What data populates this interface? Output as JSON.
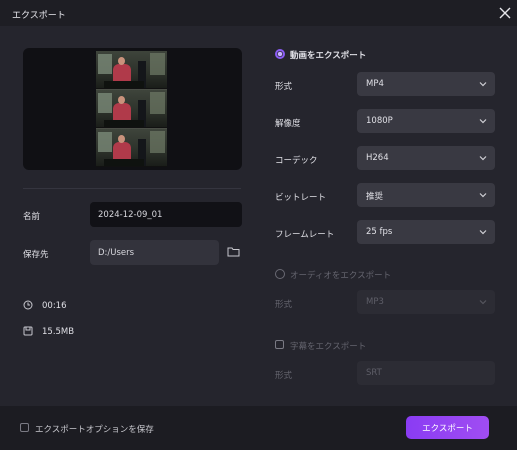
{
  "window": {
    "title": "エクスポート"
  },
  "left": {
    "name_label": "名前",
    "name_value": "2024-12-09_01",
    "save_label": "保存先",
    "save_value": "D:/Users",
    "duration": "00:16",
    "size": "15.5MB"
  },
  "video_section": {
    "radio_label": "動画をエクスポート",
    "rows": [
      {
        "label": "形式",
        "value": "MP4"
      },
      {
        "label": "解像度",
        "value": "1080P"
      },
      {
        "label": "コーデック",
        "value": "H264"
      },
      {
        "label": "ビットレート",
        "value": "推奨"
      },
      {
        "label": "フレームレート",
        "value": "25  fps"
      }
    ]
  },
  "audio_section": {
    "radio_label": "オーディオをエクスポート",
    "format_label": "形式",
    "format_value": "MP3"
  },
  "subtitle_section": {
    "check_label": "字幕をエクスポート",
    "format_label": "形式",
    "format_value": "SRT"
  },
  "footer": {
    "save_options_label": "エクスポートオプションを保存",
    "export_button": "エクスポート"
  },
  "colors": {
    "accent": "#8b5cf6",
    "button": "#9a46f2",
    "panel": "#25252d"
  }
}
